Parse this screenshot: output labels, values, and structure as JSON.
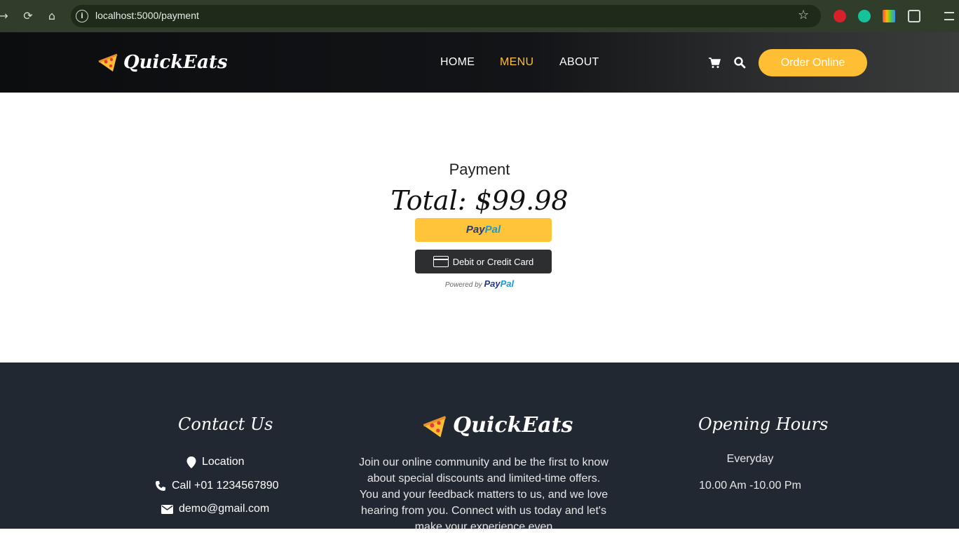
{
  "browser": {
    "url": "localhost:5000/payment"
  },
  "header": {
    "brand": "QuickEats",
    "nav": [
      {
        "label": "HOME"
      },
      {
        "label": "MENU"
      },
      {
        "label": "ABOUT"
      }
    ],
    "order_button": "Order Online",
    "accent_color": "#ffbe33"
  },
  "payment": {
    "title": "Payment",
    "total": "Total: $99.98",
    "paypal_button": {
      "part1": "Pay",
      "part2": "Pal"
    },
    "card_button": "Debit or Credit Card",
    "powered_by": "Powered by",
    "powered_brand": {
      "part1": "Pay",
      "part2": "Pal"
    }
  },
  "footer": {
    "contact": {
      "heading": "Contact Us",
      "location": "Location",
      "phone": "Call +01 1234567890",
      "email": "demo@gmail.com"
    },
    "brand": "QuickEats",
    "description": "Join our online community and be the first to know about special discounts and limited-time offers. You and your feedback matters to us, and we love hearing from you. Connect with us today and let's make your experience even",
    "hours": {
      "heading": "Opening Hours",
      "days": "Everyday",
      "time": "10.00 Am -10.00 Pm"
    }
  }
}
